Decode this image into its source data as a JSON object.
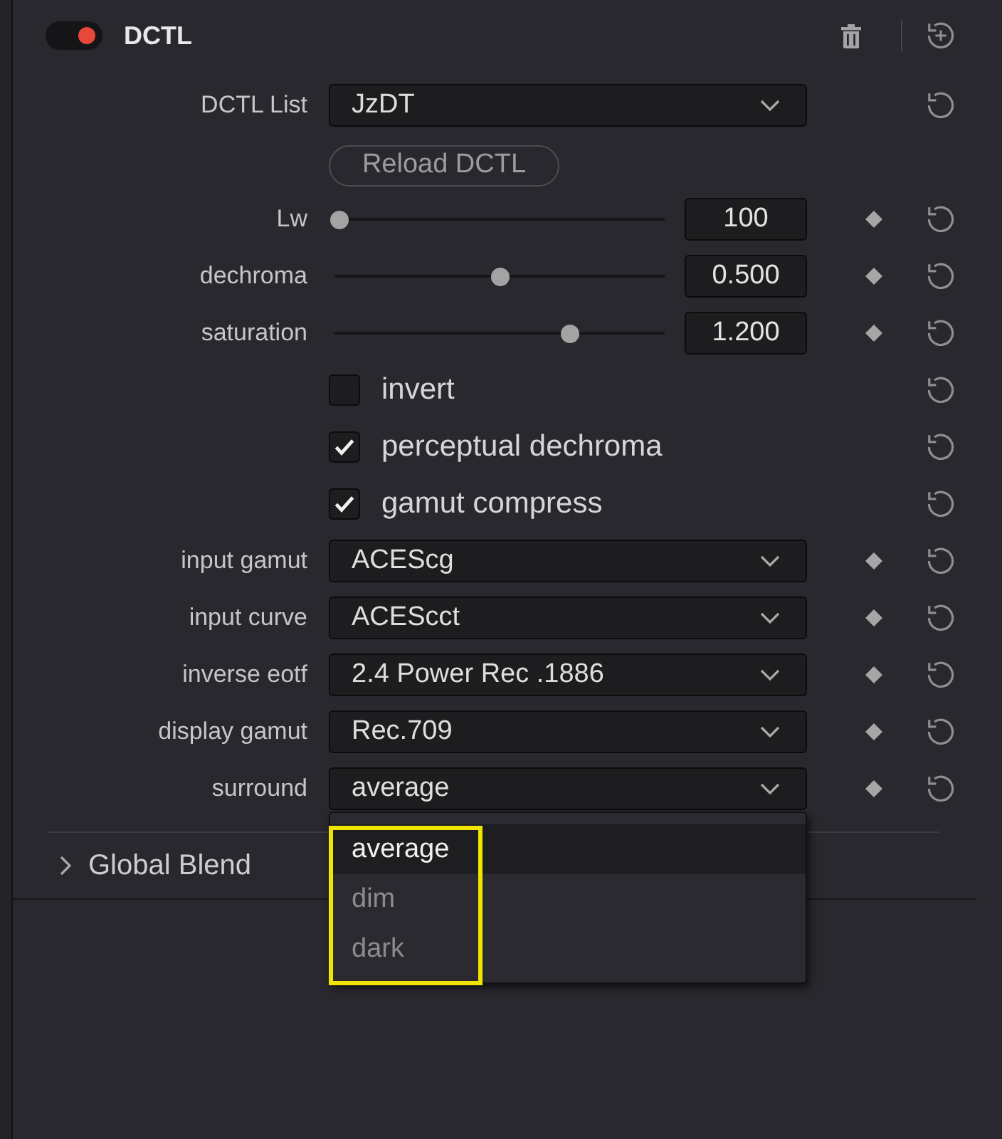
{
  "node": {
    "title": "DCTL",
    "enabled": true
  },
  "params": [
    {
      "kind": "dropdown",
      "label": "DCTL List",
      "value": "JzDT",
      "keyframeable": false,
      "resettable": true
    },
    {
      "kind": "button",
      "label": "Reload DCTL",
      "keyframeable": false,
      "resettable": false
    },
    {
      "kind": "slider",
      "label": "Lw",
      "level": 0,
      "value": "100",
      "keyframeable": true,
      "resettable": true
    },
    {
      "kind": "slider",
      "label": "dechroma",
      "level": 0.5,
      "value": "0.500",
      "keyframeable": true,
      "resettable": true
    },
    {
      "kind": "slider",
      "label": "saturation",
      "level": 0.72,
      "value": "1.200",
      "keyframeable": true,
      "resettable": true
    },
    {
      "kind": "checkbox",
      "label": "invert",
      "checked": false,
      "keyframeable": false,
      "resettable": true
    },
    {
      "kind": "checkbox",
      "label": "perceptual dechroma",
      "checked": true,
      "keyframeable": false,
      "resettable": true
    },
    {
      "kind": "checkbox",
      "label": "gamut compress",
      "checked": true,
      "keyframeable": false,
      "resettable": true
    },
    {
      "kind": "dropdown",
      "label": "input gamut",
      "value": "ACEScg",
      "keyframeable": true,
      "resettable": true
    },
    {
      "kind": "dropdown",
      "label": "input curve",
      "value": "ACEScct",
      "keyframeable": true,
      "resettable": true
    },
    {
      "kind": "dropdown",
      "label": "inverse eotf",
      "value": "2.4 Power Rec .1886",
      "keyframeable": true,
      "resettable": true
    },
    {
      "kind": "dropdown",
      "label": "display gamut",
      "value": "Rec.709",
      "keyframeable": true,
      "resettable": true
    },
    {
      "kind": "dropdown",
      "label": "surround",
      "value": "average",
      "keyframeable": true,
      "resettable": true,
      "menu": {
        "annotated": true,
        "options": [
          {
            "label": "average",
            "selected": true
          },
          {
            "label": "dim",
            "selected": false
          },
          {
            "label": "dark",
            "selected": false
          }
        ]
      }
    }
  ],
  "sections": [
    {
      "label": "Global Blend",
      "expanded": false
    }
  ]
}
